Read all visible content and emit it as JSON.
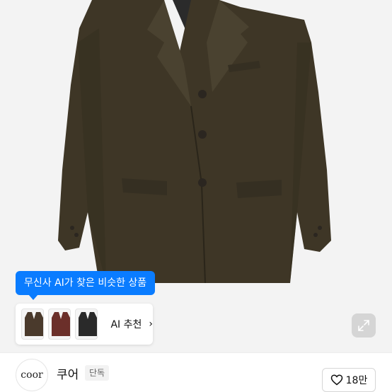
{
  "product": {
    "image_icon": "brown-wool-blazer-photo"
  },
  "ai_tooltip": {
    "text": "무신사 AI가 찾은 비슷한 상품"
  },
  "ai_recommend": {
    "label": "AI 추천",
    "thumbnails": [
      {
        "icon": "dark-brown-jacket",
        "color": "#4a3a2c"
      },
      {
        "icon": "burgundy-jacket",
        "color": "#6b2f2a"
      },
      {
        "icon": "black-jacket",
        "color": "#2a2a2a"
      }
    ],
    "chevron_icon": "chevron-right-icon"
  },
  "expand_icon": "expand-icon",
  "brand": {
    "logo_text": "coor",
    "name": "쿠어",
    "badge": "단독"
  },
  "like": {
    "icon": "heart-outline-icon",
    "count": "18만"
  },
  "colors": {
    "accent": "#0a7cff",
    "jacket": "#3e3626"
  }
}
